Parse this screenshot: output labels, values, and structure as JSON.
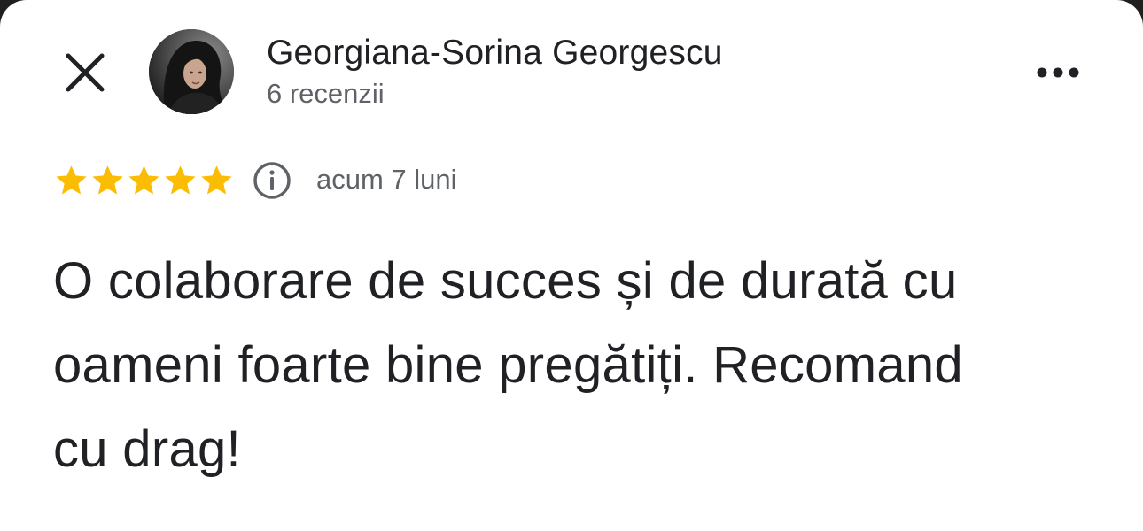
{
  "review": {
    "author": {
      "name": "Georgiana-Sorina Georgescu",
      "review_count": "6 recenzii"
    },
    "rating": 5,
    "max_rating": 5,
    "time": "acum 7 luni",
    "text": "O colaborare de succes și de durată cu oameni foarte bine pregătiți. Recomand cu drag!"
  },
  "icons": {
    "close": "close-icon",
    "more": "more-horizontal-icon",
    "info": "info-icon",
    "star": "star-icon"
  },
  "colors": {
    "star": "#fbbc04",
    "text_primary": "#202124",
    "text_secondary": "#5f6368"
  }
}
